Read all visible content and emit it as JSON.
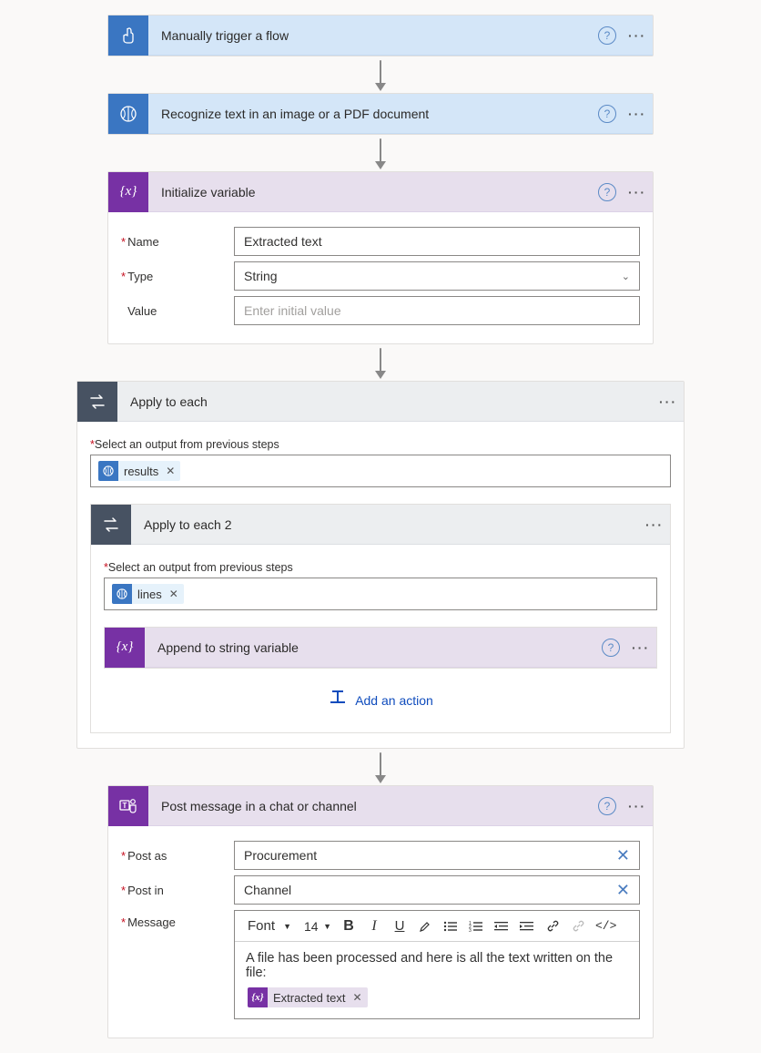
{
  "step1": {
    "title": "Manually trigger a flow"
  },
  "step2": {
    "title": "Recognize text in an image or a PDF document"
  },
  "step3": {
    "title": "Initialize variable",
    "name_label": "Name",
    "name_value": "Extracted text",
    "type_label": "Type",
    "type_value": "String",
    "value_label": "Value",
    "value_placeholder": "Enter initial value"
  },
  "step4": {
    "title": "Apply to each",
    "select_label": "Select an output from previous steps",
    "token": "results",
    "inner": {
      "title": "Apply to each 2",
      "select_label": "Select an output from previous steps",
      "token": "lines",
      "action": {
        "title": "Append to string variable"
      },
      "add_action": "Add an action"
    }
  },
  "step5": {
    "title": "Post message in a chat or channel",
    "postas_label": "Post as",
    "postas_value": "Procurement",
    "postin_label": "Post in",
    "postin_value": "Channel",
    "message_label": "Message",
    "toolbar": {
      "font": "Font",
      "size": "14"
    },
    "message_text": "A file has been processed and here is all the text written on the file:",
    "token": "Extracted text"
  }
}
